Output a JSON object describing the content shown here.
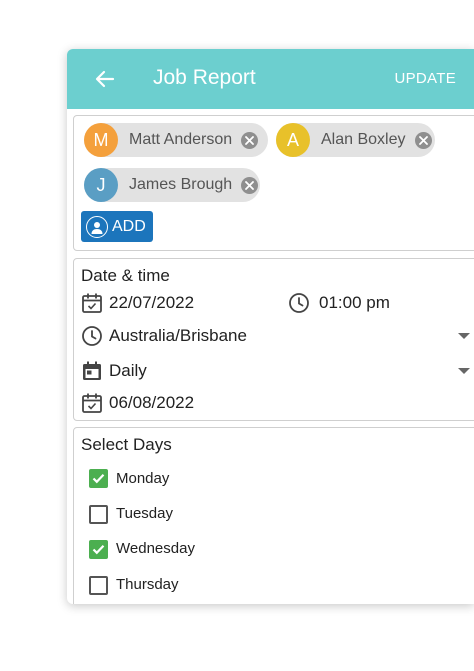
{
  "header": {
    "title": "Job Report",
    "action_label": "UPDATE",
    "color": "#6ccfcf"
  },
  "people": {
    "assignees": [
      {
        "initial": "M",
        "name": "Matt Anderson",
        "color": "#f4a03c"
      },
      {
        "initial": "A",
        "name": "Alan Boxley",
        "color": "#e8c12a"
      },
      {
        "initial": "J",
        "name": "James Brough",
        "color": "#5a9ec4"
      }
    ],
    "add_label": "ADD"
  },
  "schedule": {
    "section_title": "Date & time",
    "date": "22/07/2022",
    "time": "01:00 pm",
    "timezone": "Australia/Brisbane",
    "recurrence": "Daily",
    "end_date": "06/08/2022"
  },
  "days": {
    "section_title": "Select Days",
    "items": [
      {
        "label": "Monday",
        "checked": true
      },
      {
        "label": "Tuesday",
        "checked": false
      },
      {
        "label": "Wednesday",
        "checked": true
      },
      {
        "label": "Thursday",
        "checked": false
      }
    ]
  }
}
